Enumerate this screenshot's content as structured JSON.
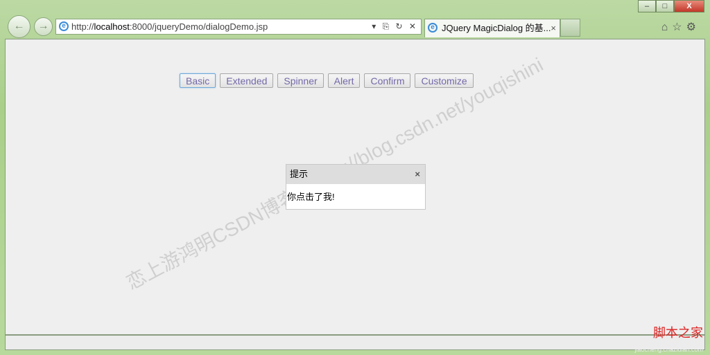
{
  "browser": {
    "url_prefix": "http://",
    "url_host": "localhost",
    "url_rest": ":8000/jqueryDemo/dialogDemo.jsp",
    "tab_title": "JQuery MagicDialog 的基...",
    "tab_close": "×",
    "window_controls": {
      "minimize": "–",
      "maximize": "□",
      "close": "X"
    },
    "back": "←",
    "forward": "→",
    "addr_icons": "▾ ⎘ ↻ ✕",
    "tools": "⌂☆⚙"
  },
  "buttons": [
    {
      "label": "Basic",
      "active": true
    },
    {
      "label": "Extended"
    },
    {
      "label": "Spinner"
    },
    {
      "label": "Alert"
    },
    {
      "label": "Confirm"
    },
    {
      "label": "Customize"
    }
  ],
  "dialog": {
    "title": "提示",
    "close": "×",
    "message": "你点击了我!"
  },
  "watermark": {
    "line1": "恋上游鸿明CSDN博客",
    "line2": "http://blog.csdn.net/youqishini"
  },
  "corner_logo": {
    "text": "脚本之家",
    "sub": "jiaocheng.chazidian.com"
  }
}
